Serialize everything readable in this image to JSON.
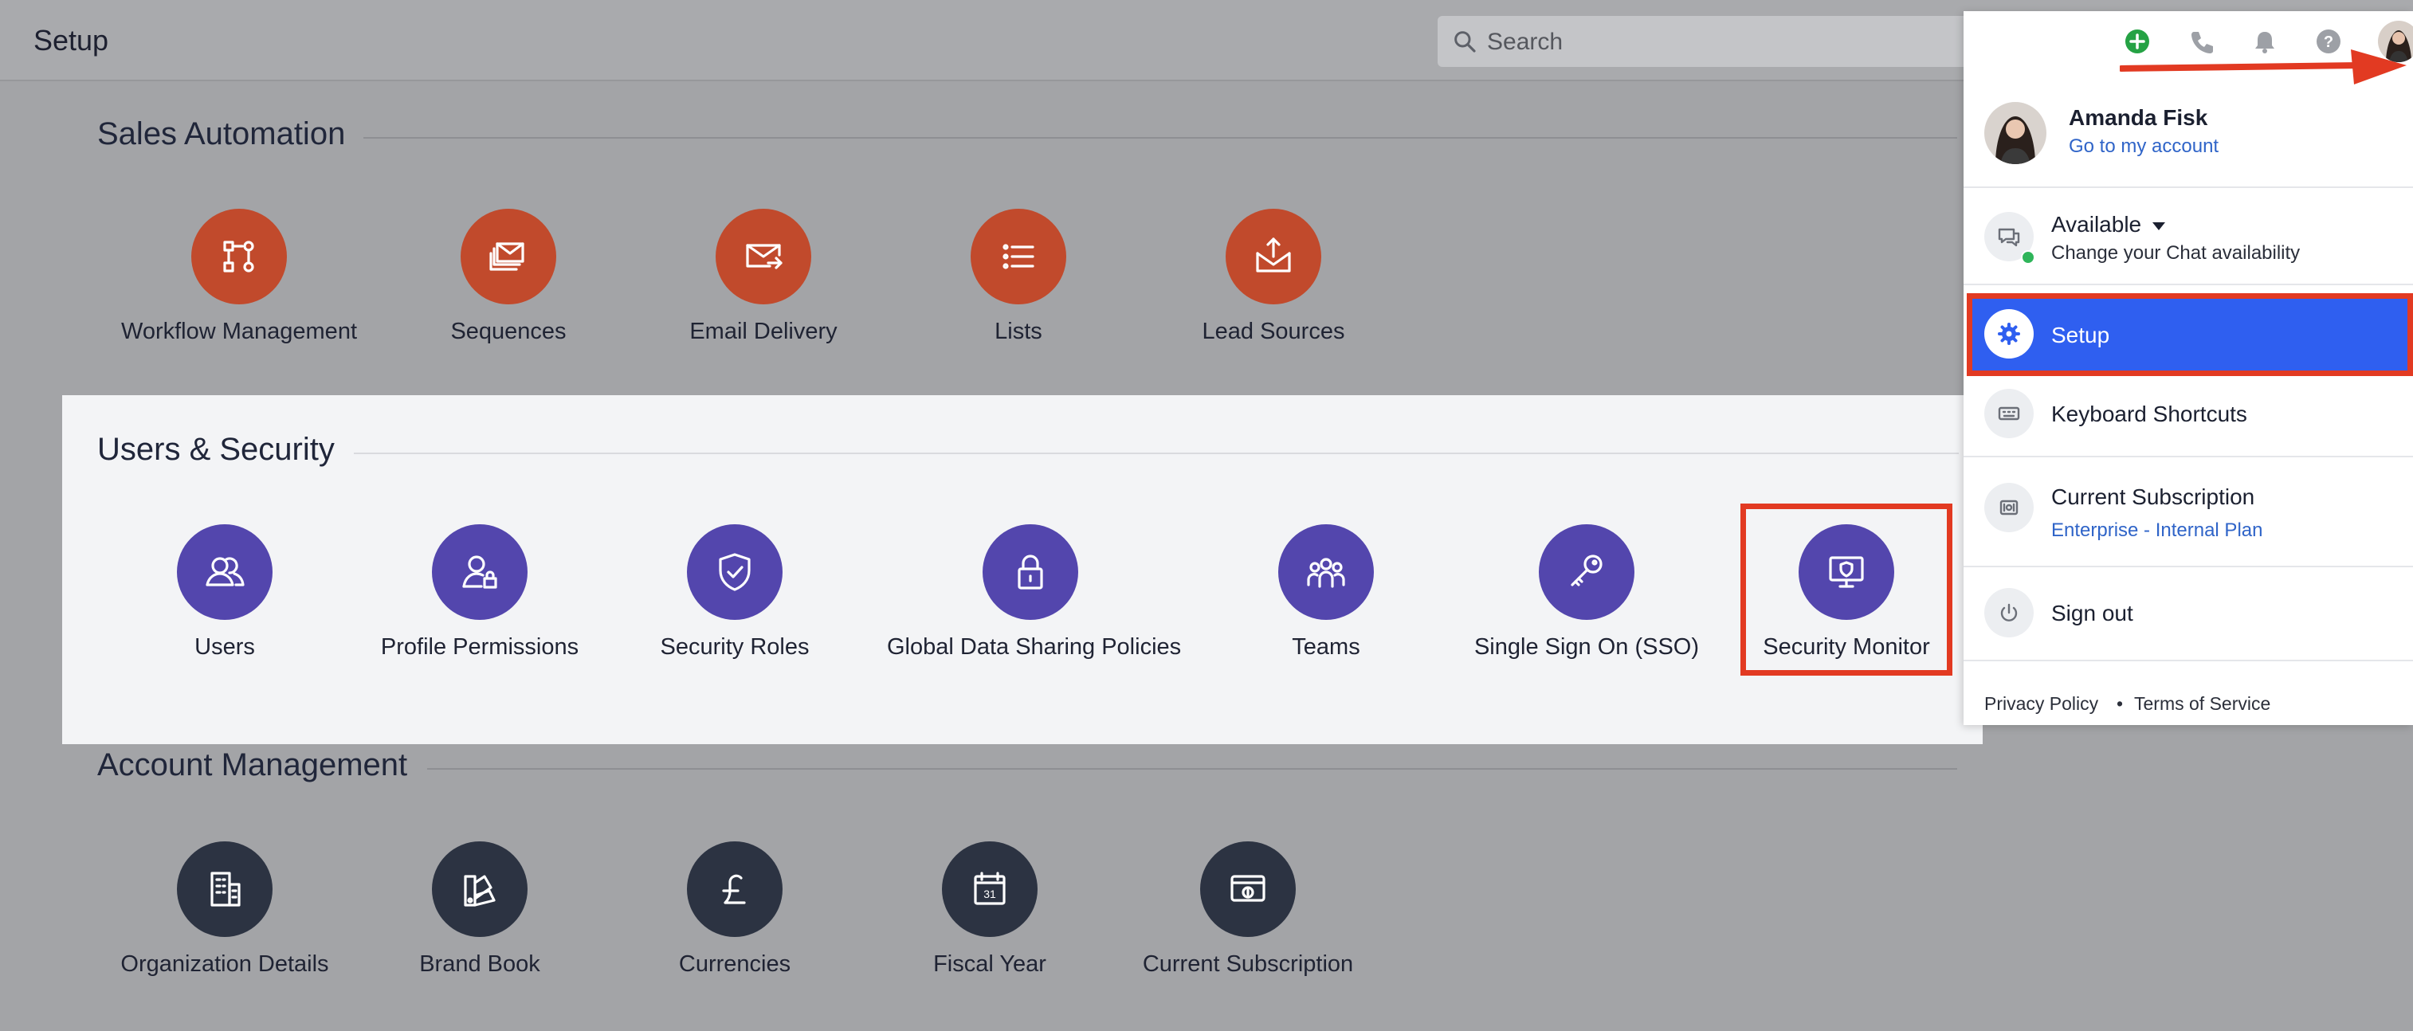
{
  "header": {
    "title": "Setup",
    "search_placeholder": "Search"
  },
  "sections": {
    "sales_automation": {
      "title": "Sales Automation",
      "tiles": [
        {
          "label": "Workflow Management",
          "icon": "workflow-icon"
        },
        {
          "label": "Sequences",
          "icon": "sequences-icon"
        },
        {
          "label": "Email Delivery",
          "icon": "email-delivery-icon"
        },
        {
          "label": "Lists",
          "icon": "list-icon"
        },
        {
          "label": "Lead Sources",
          "icon": "lead-sources-icon"
        }
      ]
    },
    "users_security": {
      "title": "Users & Security",
      "tiles": [
        {
          "label": "Users",
          "icon": "users-icon"
        },
        {
          "label": "Profile Permissions",
          "icon": "profile-permissions-icon"
        },
        {
          "label": "Security Roles",
          "icon": "shield-check-icon"
        },
        {
          "label": "Global Data Sharing Policies",
          "icon": "lock-icon"
        },
        {
          "label": "Teams",
          "icon": "teams-icon"
        },
        {
          "label": "Single Sign On (SSO)",
          "icon": "key-icon"
        },
        {
          "label": "Security Monitor",
          "icon": "monitor-shield-icon"
        }
      ]
    },
    "account_management": {
      "title": "Account Management",
      "tiles": [
        {
          "label": "Organization Details",
          "icon": "building-icon"
        },
        {
          "label": "Brand Book",
          "icon": "brand-book-icon"
        },
        {
          "label": "Currencies",
          "icon": "pound-icon"
        },
        {
          "label": "Fiscal Year",
          "icon": "calendar-icon",
          "calendar_day": "31"
        },
        {
          "label": "Current Subscription",
          "icon": "subscription-icon"
        }
      ]
    }
  },
  "user_menu": {
    "name": "Amanda Fisk",
    "account_link": "Go to my account",
    "availability_status": "Available",
    "availability_sub": "Change your Chat availability",
    "setup": "Setup",
    "keyboard_shortcuts": "Keyboard Shortcuts",
    "subscription_title": "Current Subscription",
    "subscription_plan": "Enterprise - Internal Plan",
    "sign_out": "Sign out",
    "privacy_policy": "Privacy Policy",
    "separator": "•",
    "terms": "Terms of Service"
  },
  "colors": {
    "sales_automation": "#c14a2c",
    "users_security": "#5346ad",
    "account_management": "#2c3342",
    "setup_highlight": "#2f5ff0",
    "annotation_red": "#e23a22"
  }
}
